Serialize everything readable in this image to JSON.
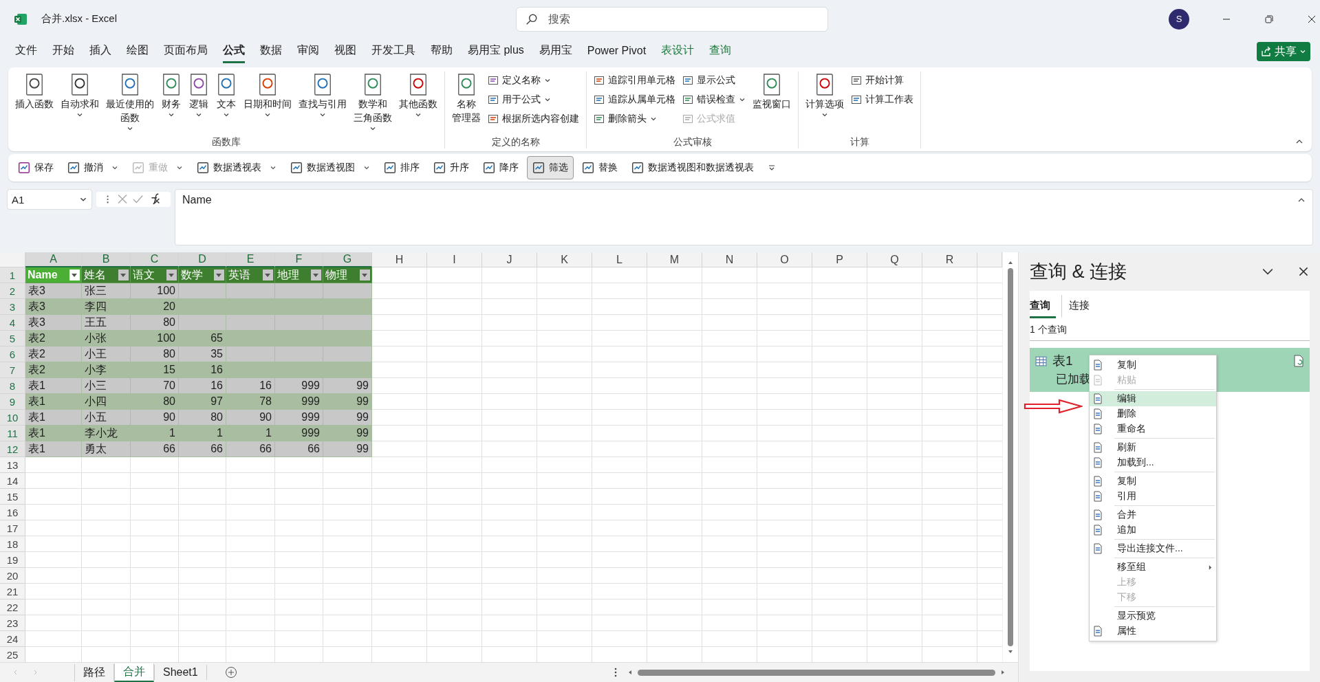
{
  "window": {
    "title": "合并.xlsx - Excel"
  },
  "search": {
    "placeholder": "搜索"
  },
  "account": {
    "initial": "S"
  },
  "menu_tabs": [
    {
      "label": "文件",
      "selected": false,
      "contextual": false
    },
    {
      "label": "开始",
      "selected": false,
      "contextual": false
    },
    {
      "label": "插入",
      "selected": false,
      "contextual": false
    },
    {
      "label": "绘图",
      "selected": false,
      "contextual": false
    },
    {
      "label": "页面布局",
      "selected": false,
      "contextual": false
    },
    {
      "label": "公式",
      "selected": true,
      "contextual": false
    },
    {
      "label": "数据",
      "selected": false,
      "contextual": false
    },
    {
      "label": "审阅",
      "selected": false,
      "contextual": false
    },
    {
      "label": "视图",
      "selected": false,
      "contextual": false
    },
    {
      "label": "开发工具",
      "selected": false,
      "contextual": false
    },
    {
      "label": "帮助",
      "selected": false,
      "contextual": false
    },
    {
      "label": "易用宝 plus",
      "selected": false,
      "contextual": false
    },
    {
      "label": "易用宝",
      "selected": false,
      "contextual": false
    },
    {
      "label": "Power Pivot",
      "selected": false,
      "contextual": false
    },
    {
      "label": "表设计",
      "selected": false,
      "contextual": true
    },
    {
      "label": "查询",
      "selected": false,
      "contextual": true
    }
  ],
  "share_button": {
    "label": "共享"
  },
  "ribbon": {
    "groups": [
      {
        "label": "函数库",
        "columns": [
          [
            {
              "kind": "large",
              "label": "插入函数",
              "dropdown": false,
              "disabled": false
            }
          ],
          [
            {
              "kind": "large",
              "label": "自动求和",
              "dropdown": true,
              "disabled": false
            }
          ],
          [
            {
              "kind": "large",
              "lines": [
                "最近使用的",
                "函数"
              ],
              "dropdown": true,
              "disabled": false
            }
          ],
          [
            {
              "kind": "large",
              "label": "财务",
              "dropdown": true,
              "disabled": false
            }
          ],
          [
            {
              "kind": "large",
              "label": "逻辑",
              "dropdown": true,
              "disabled": false
            }
          ],
          [
            {
              "kind": "large",
              "label": "文本",
              "dropdown": true,
              "disabled": false
            }
          ],
          [
            {
              "kind": "large",
              "label": "日期和时间",
              "dropdown": true,
              "disabled": false
            }
          ],
          [
            {
              "kind": "large",
              "label": "查找与引用",
              "dropdown": true,
              "disabled": false
            }
          ],
          [
            {
              "kind": "large",
              "lines": [
                "数学和",
                "三角函数"
              ],
              "dropdown": true,
              "disabled": false
            }
          ],
          [
            {
              "kind": "large",
              "label": "其他函数",
              "dropdown": true,
              "disabled": false
            }
          ]
        ]
      },
      {
        "label": "定义的名称",
        "columns": [
          [
            {
              "kind": "large",
              "lines": [
                "名称",
                "管理器"
              ],
              "dropdown": false,
              "disabled": false
            }
          ],
          [
            {
              "kind": "small",
              "label": "定义名称",
              "dropdown": true,
              "disabled": false
            },
            {
              "kind": "small",
              "label": "用于公式",
              "dropdown": true,
              "disabled": false
            },
            {
              "kind": "small",
              "label": "根据所选内容创建",
              "dropdown": false,
              "disabled": false
            }
          ]
        ]
      },
      {
        "label": "公式审核",
        "columns": [
          [
            {
              "kind": "small",
              "label": "追踪引用单元格",
              "dropdown": false,
              "disabled": false
            },
            {
              "kind": "small",
              "label": "追踪从属单元格",
              "dropdown": false,
              "disabled": false
            },
            {
              "kind": "small",
              "label": "删除箭头",
              "dropdown": true,
              "disabled": false
            }
          ],
          [
            {
              "kind": "small",
              "label": "显示公式",
              "dropdown": false,
              "disabled": false
            },
            {
              "kind": "small",
              "label": "错误检查",
              "dropdown": true,
              "disabled": false
            },
            {
              "kind": "small",
              "label": "公式求值",
              "dropdown": false,
              "disabled": true
            }
          ],
          [
            {
              "kind": "large",
              "label": "监视窗口",
              "dropdown": false,
              "disabled": false
            }
          ]
        ]
      },
      {
        "label": "计算",
        "columns": [
          [
            {
              "kind": "large",
              "label": "计算选项",
              "dropdown": true,
              "disabled": false
            }
          ],
          [
            {
              "kind": "small",
              "label": "开始计算",
              "dropdown": false,
              "disabled": false
            },
            {
              "kind": "small",
              "label": "计算工作表",
              "dropdown": false,
              "disabled": false
            }
          ]
        ]
      }
    ]
  },
  "quick_access": [
    {
      "label": "保存",
      "dropdown": false,
      "disabled": false,
      "pressed": false
    },
    {
      "label": "撤消",
      "dropdown": true,
      "disabled": false,
      "pressed": false
    },
    {
      "label": "重做",
      "dropdown": true,
      "disabled": true,
      "pressed": false
    },
    {
      "label": "数据透视表",
      "dropdown": true,
      "disabled": false,
      "pressed": false
    },
    {
      "label": "数据透视图",
      "dropdown": true,
      "disabled": false,
      "pressed": false
    },
    {
      "label": "排序",
      "dropdown": false,
      "disabled": false,
      "pressed": false
    },
    {
      "label": "升序",
      "dropdown": false,
      "disabled": false,
      "pressed": false
    },
    {
      "label": "降序",
      "dropdown": false,
      "disabled": false,
      "pressed": false
    },
    {
      "label": "筛选",
      "dropdown": false,
      "disabled": false,
      "pressed": true
    },
    {
      "label": "替换",
      "dropdown": false,
      "disabled": false,
      "pressed": false
    },
    {
      "label": "数据透视图和数据透视表",
      "dropdown": false,
      "disabled": false,
      "pressed": false
    }
  ],
  "formula_bar": {
    "name_box": "A1",
    "formula": "Name"
  },
  "sheet": {
    "columns": [
      {
        "label": "A",
        "selected": true
      },
      {
        "label": "B",
        "selected": true
      },
      {
        "label": "C",
        "selected": true
      },
      {
        "label": "D",
        "selected": true
      },
      {
        "label": "E",
        "selected": true
      },
      {
        "label": "F",
        "selected": true
      },
      {
        "label": "G",
        "selected": true
      },
      {
        "label": "H",
        "selected": false
      },
      {
        "label": "I",
        "selected": false
      },
      {
        "label": "J",
        "selected": false
      },
      {
        "label": "K",
        "selected": false
      },
      {
        "label": "L",
        "selected": false
      },
      {
        "label": "M",
        "selected": false
      },
      {
        "label": "N",
        "selected": false
      },
      {
        "label": "O",
        "selected": false
      },
      {
        "label": "P",
        "selected": false
      },
      {
        "label": "Q",
        "selected": false
      },
      {
        "label": "R",
        "selected": false
      }
    ],
    "rows": [
      {
        "number": "1",
        "selected": true,
        "cells": [
          "Name",
          "姓名",
          "语文",
          "数学",
          "英语",
          "地理",
          "物理"
        ]
      },
      {
        "number": "2",
        "selected": true,
        "cells": [
          "表3",
          "张三",
          "100",
          null,
          null,
          null,
          null
        ]
      },
      {
        "number": "3",
        "selected": true,
        "cells": [
          "表3",
          "李四",
          "20",
          null,
          null,
          null,
          null
        ]
      },
      {
        "number": "4",
        "selected": true,
        "cells": [
          "表3",
          "王五",
          "80",
          null,
          null,
          null,
          null
        ]
      },
      {
        "number": "5",
        "selected": true,
        "cells": [
          "表2",
          "小张",
          "100",
          "65",
          null,
          null,
          null
        ]
      },
      {
        "number": "6",
        "selected": true,
        "cells": [
          "表2",
          "小王",
          "80",
          "35",
          null,
          null,
          null
        ]
      },
      {
        "number": "7",
        "selected": true,
        "cells": [
          "表2",
          "小李",
          "15",
          "16",
          null,
          null,
          null
        ]
      },
      {
        "number": "8",
        "selected": true,
        "cells": [
          "表1",
          "小三",
          "70",
          "16",
          "16",
          "999",
          "99"
        ]
      },
      {
        "number": "9",
        "selected": true,
        "cells": [
          "表1",
          "小四",
          "80",
          "97",
          "78",
          "999",
          "99"
        ]
      },
      {
        "number": "10",
        "selected": true,
        "cells": [
          "表1",
          "小五",
          "90",
          "80",
          "90",
          "999",
          "99"
        ]
      },
      {
        "number": "11",
        "selected": true,
        "cells": [
          "表1",
          "李小龙",
          "1",
          "1",
          "1",
          "999",
          "99"
        ]
      },
      {
        "number": "12",
        "selected": true,
        "cells": [
          "表1",
          "勇太",
          "66",
          "66",
          "66",
          "66",
          "99"
        ]
      },
      {
        "number": "13",
        "selected": false
      },
      {
        "number": "14",
        "selected": false
      },
      {
        "number": "15",
        "selected": false
      },
      {
        "number": "16",
        "selected": false
      },
      {
        "number": "17",
        "selected": false
      },
      {
        "number": "18",
        "selected": false
      },
      {
        "number": "19",
        "selected": false
      },
      {
        "number": "20",
        "selected": false
      },
      {
        "number": "21",
        "selected": false
      },
      {
        "number": "22",
        "selected": false
      },
      {
        "number": "23",
        "selected": false
      },
      {
        "number": "24",
        "selected": false
      },
      {
        "number": "25",
        "selected": false
      }
    ]
  },
  "sheet_tabs": [
    {
      "label": "路径",
      "selected": false
    },
    {
      "label": "合并",
      "selected": true
    },
    {
      "label": "Sheet1",
      "selected": false
    }
  ],
  "queries_panel": {
    "title": "查询 & 连接",
    "tabs": [
      {
        "label": "查询",
        "selected": true
      },
      {
        "label": "连接",
        "selected": false
      }
    ],
    "count": "1 个查询",
    "items": [
      {
        "name": "表1",
        "status": "已加载",
        "selected": true
      }
    ]
  },
  "context_menu": {
    "groups": [
      [
        {
          "label": "复制",
          "disabled": false,
          "selected": false,
          "submenu": false
        },
        {
          "label": "粘贴",
          "disabled": true,
          "selected": false,
          "submenu": false
        }
      ],
      [
        {
          "label": "编辑",
          "disabled": false,
          "selected": true,
          "submenu": false
        },
        {
          "label": "删除",
          "disabled": false,
          "selected": false,
          "submenu": false
        },
        {
          "label": "重命名",
          "disabled": false,
          "selected": false,
          "submenu": false
        }
      ],
      [
        {
          "label": "刷新",
          "disabled": false,
          "selected": false,
          "submenu": false
        },
        {
          "label": "加载到...",
          "disabled": false,
          "selected": false,
          "submenu": false
        }
      ],
      [
        {
          "label": "复制",
          "disabled": false,
          "selected": false,
          "submenu": false
        },
        {
          "label": "引用",
          "disabled": false,
          "selected": false,
          "submenu": false
        }
      ],
      [
        {
          "label": "合并",
          "disabled": false,
          "selected": false,
          "submenu": false
        },
        {
          "label": "追加",
          "disabled": false,
          "selected": false,
          "submenu": false
        }
      ],
      [
        {
          "label": "导出连接文件...",
          "disabled": false,
          "selected": false,
          "submenu": false
        }
      ],
      [
        {
          "label": "移至组",
          "disabled": false,
          "selected": false,
          "submenu": true
        },
        {
          "label": "上移",
          "disabled": true,
          "selected": false,
          "submenu": false
        },
        {
          "label": "下移",
          "disabled": true,
          "selected": false,
          "submenu": false
        }
      ],
      [
        {
          "label": "显示预览",
          "disabled": false,
          "selected": false,
          "submenu": false
        },
        {
          "label": "属性",
          "disabled": false,
          "selected": false,
          "submenu": false
        }
      ]
    ]
  }
}
